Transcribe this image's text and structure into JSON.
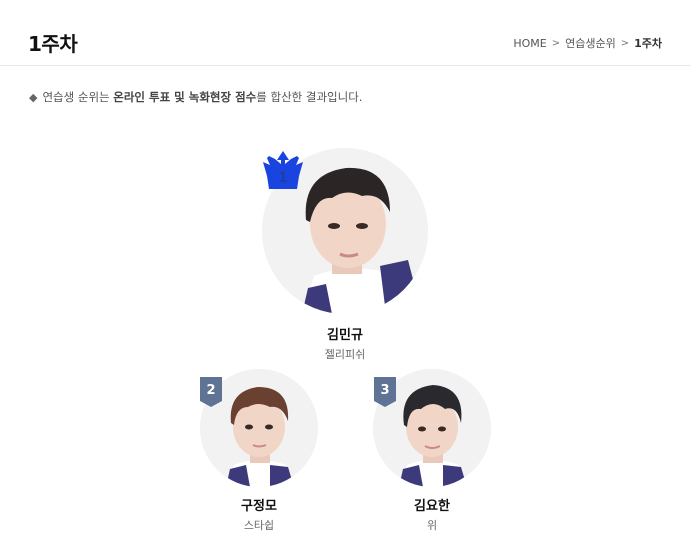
{
  "header": {
    "title": "1주차",
    "breadcrumb": {
      "home": "HOME",
      "section": "연습생순위",
      "current": "1주차"
    }
  },
  "notice": {
    "bullet": "◆",
    "text_1": "연습생 순위는",
    "bold_1": "온라인 투표 및 녹화현장 점수",
    "text_2": "를 합산한 결과입니다."
  },
  "ranking": [
    {
      "rank": "1",
      "name": "김민규",
      "agency": "젤리피쉬"
    },
    {
      "rank": "2",
      "name": "구정모",
      "agency": "스타쉽"
    },
    {
      "rank": "3",
      "name": "김요한",
      "agency": "위"
    }
  ],
  "colors": {
    "crown": "#1a44e0",
    "flag": "#5f7495",
    "avatar_bg": "#f2f2f2",
    "jacket": "#3c3a7a",
    "hair_1": "#2b2625",
    "hair_2": "#6a4030",
    "hair_3": "#2a2a2e",
    "skin": "#f1d6c8"
  },
  "icons": {
    "crown": "crown-icon",
    "flag": "rank-flag-icon",
    "breadcrumb_separator": "chevron-right-icon"
  }
}
